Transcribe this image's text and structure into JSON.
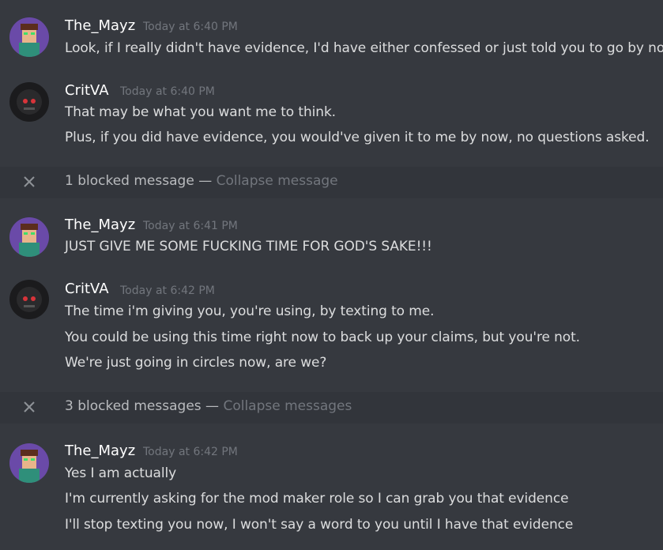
{
  "messages": [
    {
      "author": "The_Mayz",
      "timestamp": "Today at 6:40 PM",
      "avatar_icon": "mayz-avatar-icon",
      "lines": [
        "Look, if I really didn't have evidence, I'd have either confessed or just told you to go by now"
      ]
    },
    {
      "author": "CritVA",
      "timestamp": "Today at 6:40 PM",
      "avatar_icon": "critva-avatar-icon",
      "lines": [
        "That may be what you want me to think.",
        "Plus, if you did have evidence, you would've given it to me by now, no questions asked."
      ]
    },
    {
      "author": "The_Mayz",
      "timestamp": "Today at 6:41 PM",
      "avatar_icon": "mayz-avatar-icon",
      "lines": [
        "JUST GIVE ME SOME FUCKING TIME FOR GOD'S SAKE!!!"
      ]
    },
    {
      "author": "CritVA",
      "timestamp": "Today at 6:42 PM",
      "avatar_icon": "critva-avatar-icon",
      "lines": [
        "The time i'm giving you, you're using, by texting to me.",
        "You could be using this time right now to back up your claims, but you're not.",
        "We're just going in circles now, are we?"
      ]
    },
    {
      "author": "The_Mayz",
      "timestamp": "Today at 6:42 PM",
      "avatar_icon": "mayz-avatar-icon",
      "lines": [
        "Yes I am actually",
        "I'm currently asking for the mod maker role so I can grab you that evidence",
        "I'll stop texting you now, I won't say a word to you until I have that evidence"
      ]
    }
  ],
  "blocked": [
    {
      "text": "1 blocked message",
      "separator": "—",
      "collapse_label": "Collapse message"
    },
    {
      "text": "3 blocked messages",
      "separator": "—",
      "collapse_label": "Collapse messages"
    }
  ],
  "colors": {
    "background": "#36393f",
    "blocked_background": "#32353b",
    "username": "#ffffff",
    "message_text": "#dcddde",
    "timestamp": "#72767d"
  }
}
